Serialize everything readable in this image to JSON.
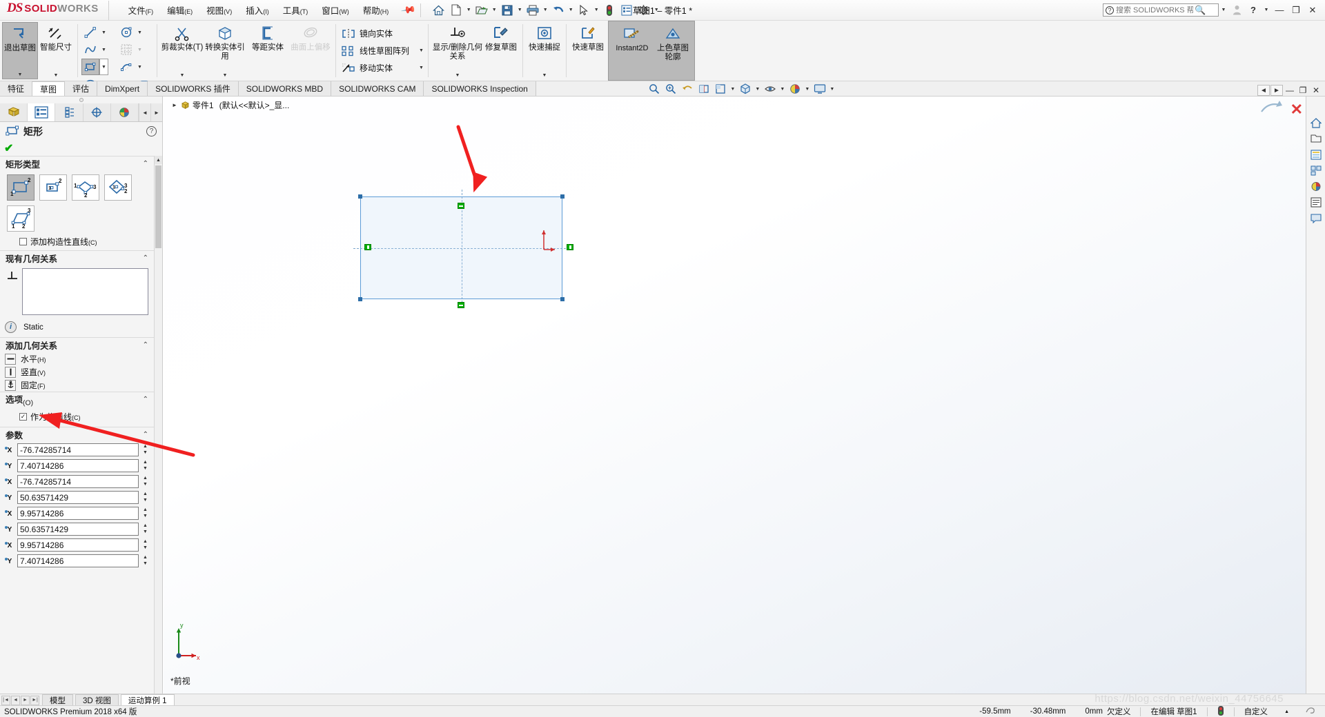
{
  "titlebar": {
    "brand": {
      "ds": "DS",
      "solid": "SOLID",
      "works": "WORKS"
    },
    "menus": [
      {
        "label": "文件",
        "accel": "(F)"
      },
      {
        "label": "编辑",
        "accel": "(E)"
      },
      {
        "label": "视图",
        "accel": "(V)"
      },
      {
        "label": "插入",
        "accel": "(I)"
      },
      {
        "label": "工具",
        "accel": "(T)"
      },
      {
        "label": "窗口",
        "accel": "(W)"
      },
      {
        "label": "帮助",
        "accel": "(H)"
      }
    ],
    "quick_access": [
      {
        "name": "home-icon",
        "glyph": "⌂"
      },
      {
        "name": "new-document-icon",
        "glyph": "🗋"
      },
      {
        "name": "open-folder-icon",
        "glyph": "📂"
      },
      {
        "name": "save-icon",
        "glyph": "💾"
      },
      {
        "name": "print-icon",
        "glyph": "🖨"
      },
      {
        "name": "undo-icon",
        "glyph": "↩"
      },
      {
        "name": "select-cursor-icon",
        "glyph": "➤"
      },
      {
        "name": "rebuild-icon",
        "glyph": "🚦"
      },
      {
        "name": "options-list-icon",
        "glyph": "▤"
      },
      {
        "name": "settings-gear-icon",
        "glyph": "⚙"
      }
    ],
    "document_title": "草图1 – 零件1 *",
    "search_placeholder": "搜索 SOLIDWORKS 帮助",
    "window_buttons": {
      "minimize": "—",
      "restore": "❐",
      "close": "✕",
      "help": "?",
      "account": "👤"
    }
  },
  "ribbon": {
    "exit_sketch": "退出草图",
    "smart_dimension": "智能尺寸",
    "sketch_tools": [
      {
        "name": "line-tool",
        "glyph": "╱",
        "caret": true
      },
      {
        "name": "circle-tool",
        "glyph": "◎",
        "caret": true
      },
      {
        "name": "spline-tool",
        "glyph": "∿",
        "caret": true
      },
      {
        "name": "pattern-tool",
        "glyph": "▦",
        "caret": false
      },
      {
        "name": "rectangle-tool",
        "glyph": "▭",
        "caret": true,
        "selected": true
      },
      {
        "name": "arc-tool",
        "glyph": "◡",
        "caret": true
      },
      {
        "name": "ellipse-tool",
        "glyph": "⬭",
        "caret": true
      },
      {
        "name": "text-tool",
        "glyph": "A",
        "caret": false
      },
      {
        "name": "slot-tool",
        "glyph": "▬",
        "caret": true
      },
      {
        "name": "polygon-tool",
        "glyph": "⬡",
        "caret": false
      },
      {
        "name": "fillet-tool",
        "glyph": "◜",
        "caret": true
      },
      {
        "name": "point-tool",
        "glyph": "▪",
        "caret": false
      }
    ],
    "trim_entities": "剪裁实体(T)",
    "convert_entities": "转换实体引用",
    "offset_entities": "等距实体",
    "offset_on_surface": "曲面上偏移",
    "mirror_entities": "镜向实体",
    "linear_sketch_pattern": "线性草图阵列",
    "move_entities": "移动实体",
    "display_delete_relations": "显示/删除几何关系",
    "repair_sketch": "修复草图",
    "quick_snaps": "快速捕捉",
    "quick_sketch": "快速草图",
    "instant_2d": "Instant2D",
    "shaded_sketch_contours": "上色草图轮廓"
  },
  "tabs": [
    {
      "label": "特征",
      "active": false
    },
    {
      "label": "草图",
      "active": true
    },
    {
      "label": "评估",
      "active": false
    },
    {
      "label": "DimXpert",
      "active": false
    },
    {
      "label": "SOLIDWORKS 插件",
      "active": false
    },
    {
      "label": "SOLIDWORKS MBD",
      "active": false
    },
    {
      "label": "SOLIDWORKS CAM",
      "active": false
    },
    {
      "label": "SOLIDWORKS Inspection",
      "active": false
    }
  ],
  "view_toolbar": [
    {
      "name": "zoom-to-fit-icon",
      "glyph": "🔍"
    },
    {
      "name": "zoom-area-icon",
      "glyph": "⊕"
    },
    {
      "name": "previous-view-icon",
      "glyph": "↺"
    },
    {
      "name": "section-view-icon",
      "glyph": "◧"
    },
    {
      "name": "view-orientation-icon",
      "glyph": "⬚"
    },
    {
      "name": "display-style-icon",
      "glyph": "◰"
    },
    {
      "name": "hide-show-icon",
      "glyph": "👁"
    },
    {
      "name": "apply-scene-icon",
      "glyph": "🎨"
    },
    {
      "name": "view-settings-icon",
      "glyph": "🖥"
    }
  ],
  "property_panel": {
    "tabs": [
      {
        "name": "feature-manager-tab",
        "glyph": "◆",
        "active": false
      },
      {
        "name": "property-manager-tab",
        "glyph": "▤",
        "active": true
      },
      {
        "name": "configuration-manager-tab",
        "glyph": "⫼",
        "active": false
      },
      {
        "name": "dimxpert-manager-tab",
        "glyph": "✛",
        "active": false
      },
      {
        "name": "appearances-tab",
        "glyph": "◕",
        "active": false
      }
    ],
    "title": "矩形",
    "rectangle_type": {
      "header": "矩形类型",
      "options": [
        {
          "name": "corner-rectangle",
          "selected": true
        },
        {
          "name": "center-rectangle",
          "selected": false
        },
        {
          "name": "3-point-corner-rectangle",
          "selected": false
        },
        {
          "name": "3-point-center-rectangle",
          "selected": false
        },
        {
          "name": "parallelogram",
          "selected": false
        }
      ],
      "add_construction_lines": {
        "label": "添加构造性直线",
        "accel": "(C)",
        "checked": false
      }
    },
    "existing_relations": {
      "header": "现有几何关系",
      "items": [],
      "status": "Static"
    },
    "add_relations": {
      "header": "添加几何关系",
      "items": [
        {
          "label": "水平",
          "accel": "(H)",
          "name": "horizontal-relation"
        },
        {
          "label": "竖直",
          "accel": "(V)",
          "name": "vertical-relation"
        },
        {
          "label": "固定",
          "accel": "(F)",
          "name": "fix-relation"
        }
      ]
    },
    "options": {
      "header": "选项",
      "header_accel": "(O)",
      "for_construction": {
        "label": "作为构造线",
        "accel": "(C)",
        "checked": true
      }
    },
    "parameters": {
      "header": "参数",
      "fields": [
        {
          "axis": "X",
          "value": "-76.74285714"
        },
        {
          "axis": "Y",
          "value": "7.40714286"
        },
        {
          "axis": "X",
          "value": "-76.74285714"
        },
        {
          "axis": "Y",
          "value": "50.63571429"
        },
        {
          "axis": "X",
          "value": "9.95714286"
        },
        {
          "axis": "Y",
          "value": "50.63571429"
        },
        {
          "axis": "X",
          "value": "9.95714286"
        },
        {
          "axis": "Y",
          "value": "7.40714286"
        }
      ]
    }
  },
  "graphics": {
    "feature_tree_root": "零件1",
    "feature_tree_config": "(默认<<默认>_显...",
    "view_label": "*前视",
    "triad": {
      "x": "x",
      "y": "y"
    }
  },
  "bottom_tabs": [
    {
      "label": "模型",
      "active": false
    },
    {
      "label": "3D 视图",
      "active": false
    },
    {
      "label": "运动算例 1",
      "active": true
    }
  ],
  "statusbar": {
    "version": "SOLIDWORKS Premium 2018 x64 版",
    "coord_x": "-59.5mm",
    "coord_y": "-30.48mm",
    "coord_z": "0mm",
    "state": "欠定义",
    "editing": "在编辑 草图1",
    "custom": "自定义"
  }
}
